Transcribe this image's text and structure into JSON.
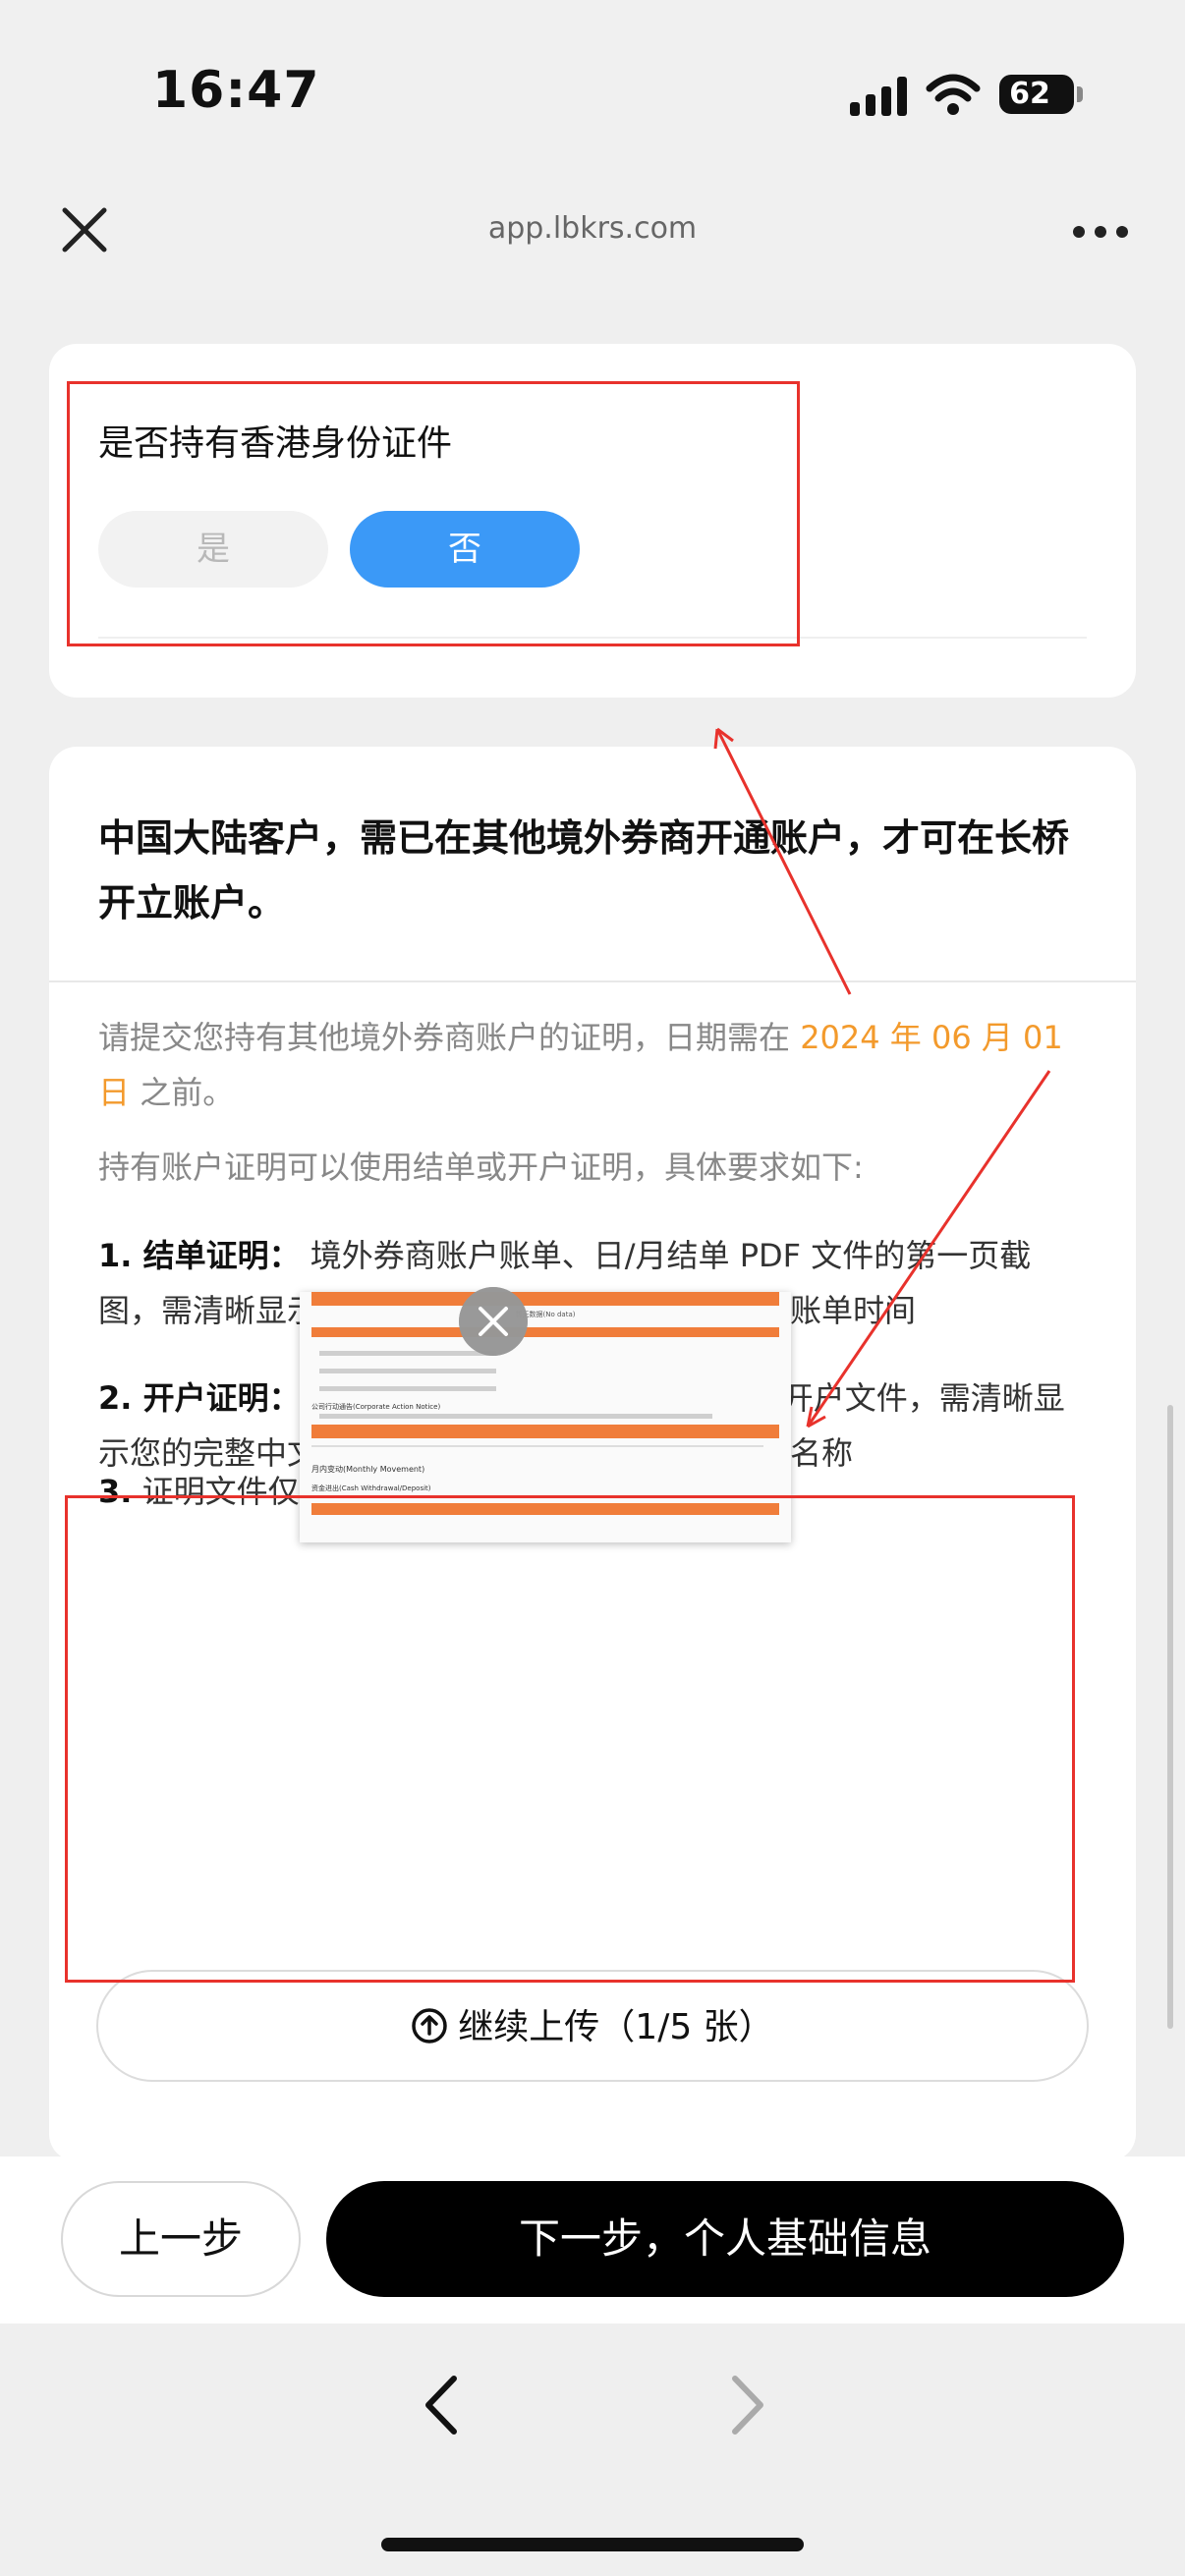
{
  "status_bar": {
    "time": "16:47",
    "battery": "62"
  },
  "nav": {
    "url": "app.lbkrs.com"
  },
  "hk_id_card": {
    "question": "是否持有香港身份证件",
    "yes_label": "是",
    "no_label": "否",
    "selected": "否"
  },
  "notice_card": {
    "heading": "中国大陆客户，需已在其他境外券商开通账户，才可在长桥开立账户。",
    "intro_prefix": "请提交您持有其他境外券商账户的证明，日期需在",
    "intro_date": "2024 年 06 月 01 日",
    "intro_suffix": "之前。",
    "requirements_intro": "持有账户证明可以使用结单或开户证明，具体要求如下:",
    "req1_title": "1. 结单证明：",
    "req1_text": "境外券商账户账单、日/月结单 PDF 文件的第一页截图，需清晰显示您的中文或英文姓名、券商名称与账单时间",
    "req2_title": "2. 开户证明：",
    "req2_text": "境外券商账户开户成功邮件截图或开户文件，需清晰显示您的完整中文或英文姓名、邮件接收时间、券商名称",
    "req3_title": "3.",
    "req3_text": "证明文件仅支持图片格式",
    "thumbnail_text": {
      "line1": "暂无数据(No data)",
      "line2": "公司行动通告(Corporate Action Notice)",
      "line3": "月内变动(Monthly Movement)",
      "line4": "资金进出(Cash Withdrawal/Deposit)"
    },
    "upload_label": "继续上传（1/5 张）"
  },
  "actions": {
    "prev_label": "上一步",
    "next_label": "下一步，个人基础信息"
  },
  "colors": {
    "selected_blue": "#3b99f7",
    "highlight_orange": "#f39a2c",
    "annotation_red": "#e8322c"
  }
}
